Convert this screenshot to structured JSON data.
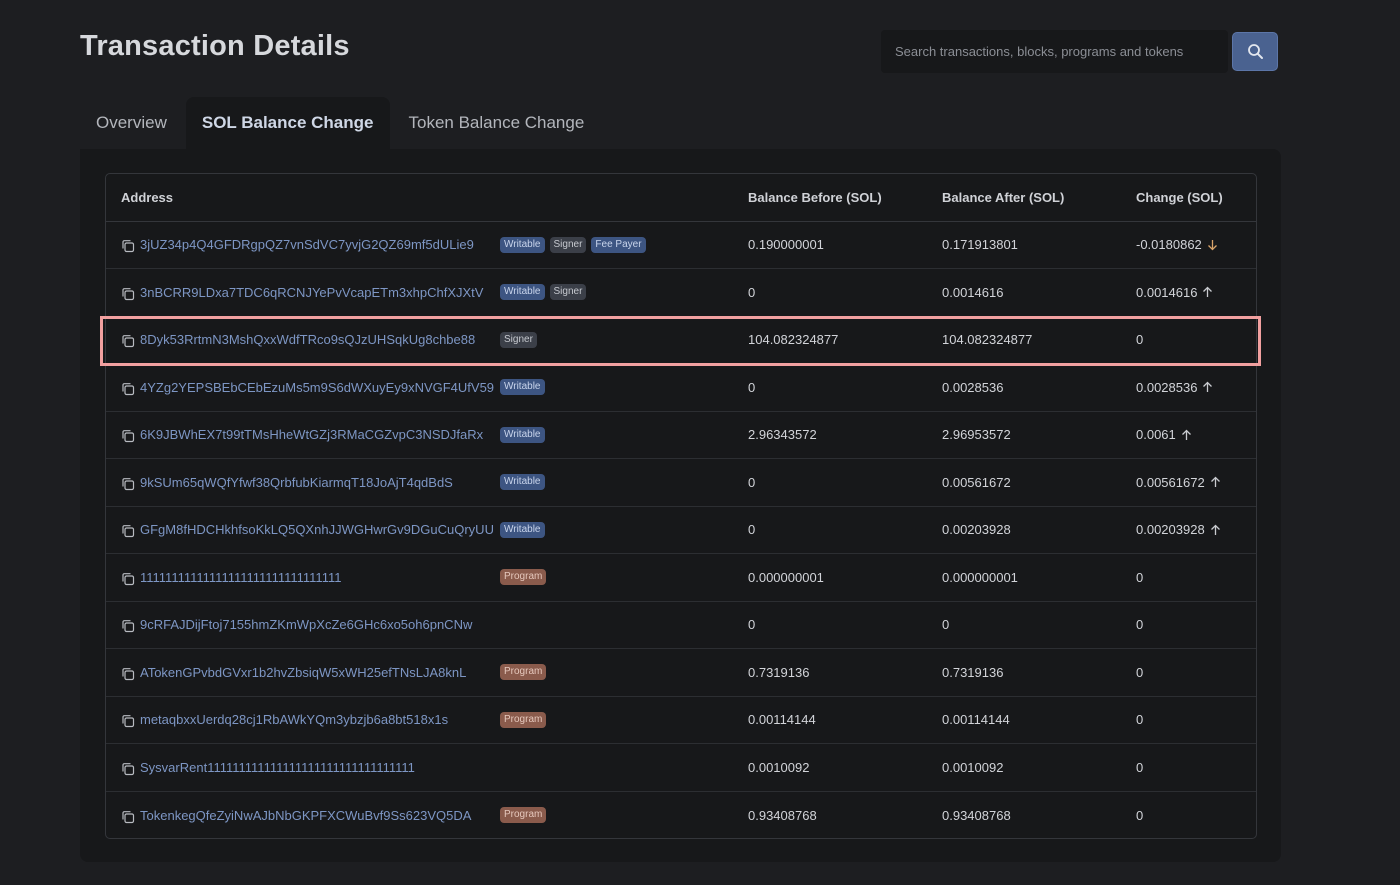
{
  "page": {
    "title": "Transaction Details"
  },
  "search": {
    "placeholder": "Search transactions, blocks, programs and tokens"
  },
  "tabs": [
    {
      "label": "Overview",
      "active": false
    },
    {
      "label": "SOL Balance Change",
      "active": true
    },
    {
      "label": "Token Balance Change",
      "active": false
    }
  ],
  "table": {
    "headers": {
      "address": "Address",
      "balance_before": "Balance Before (SOL)",
      "balance_after": "Balance After (SOL)",
      "change": "Change (SOL)"
    },
    "rows": [
      {
        "address": "3jUZ34p4Q4GFDRgpQZ7vnSdVC7yvjG2QZ69mf5dULie9",
        "badges": [
          "Writable",
          "Signer",
          "Fee Payer"
        ],
        "before": "0.190000001",
        "after": "0.171913801",
        "change": "-0.0180862",
        "direction": "down"
      },
      {
        "address": "3nBCRR9LDxa7TDC6qRCNJYePvVcapETm3xhpChfXJXtV",
        "badges": [
          "Writable",
          "Signer"
        ],
        "before": "0",
        "after": "0.0014616",
        "change": "0.0014616",
        "direction": "up"
      },
      {
        "address": "8Dyk53RrtmN3MshQxxWdfTRco9sQJzUHSqkUg8chbe88",
        "badges": [
          "Signer"
        ],
        "before": "104.082324877",
        "after": "104.082324877",
        "change": "0",
        "direction": "none"
      },
      {
        "address": "4YZg2YEPSBEbCEbEzuMs5m9S6dWXuyEy9xNVGF4UfV59",
        "badges": [
          "Writable"
        ],
        "before": "0",
        "after": "0.0028536",
        "change": "0.0028536",
        "direction": "up"
      },
      {
        "address": "6K9JBWhEX7t99tTMsHheWtGZj3RMaCGZvpC3NSDJfaRx",
        "badges": [
          "Writable"
        ],
        "before": "2.96343572",
        "after": "2.96953572",
        "change": "0.0061",
        "direction": "up"
      },
      {
        "address": "9kSUm65qWQfYfwf38QrbfubKiarmqT18JoAjT4qdBdS",
        "badges": [
          "Writable"
        ],
        "before": "0",
        "after": "0.00561672",
        "change": "0.00561672",
        "direction": "up"
      },
      {
        "address": "GFgM8fHDCHkhfsoKkLQ5QXnhJJWGHwrGv9DGuCuQryUU",
        "badges": [
          "Writable"
        ],
        "before": "0",
        "after": "0.00203928",
        "change": "0.00203928",
        "direction": "up"
      },
      {
        "address": "11111111111111111111111111111111",
        "badges": [
          "Program"
        ],
        "before": "0.000000001",
        "after": "0.000000001",
        "change": "0",
        "direction": "none"
      },
      {
        "address": "9cRFAJDijFtoj7155hmZKmWpXcZe6GHc6xo5oh6pnCNw",
        "badges": [],
        "before": "0",
        "after": "0",
        "change": "0",
        "direction": "none"
      },
      {
        "address": "ATokenGPvbdGVxr1b2hvZbsiqW5xWH25efTNsLJA8knL",
        "badges": [
          "Program"
        ],
        "before": "0.7319136",
        "after": "0.7319136",
        "change": "0",
        "direction": "none"
      },
      {
        "address": "metaqbxxUerdq28cj1RbAWkYQm3ybzjb6a8bt518x1s",
        "badges": [
          "Program"
        ],
        "before": "0.00114144",
        "after": "0.00114144",
        "change": "0",
        "direction": "none"
      },
      {
        "address": "SysvarRent111111111111111111111111111111111",
        "badges": [],
        "before": "0.0010092",
        "after": "0.0010092",
        "change": "0",
        "direction": "none"
      },
      {
        "address": "TokenkegQfeZyiNwAJbNbGKPFXCWuBvf9Ss623VQ5DA",
        "badges": [
          "Program"
        ],
        "before": "0.93408768",
        "after": "0.93408768",
        "change": "0",
        "direction": "none"
      }
    ]
  },
  "highlighted_row_index": 2,
  "icons": {
    "search": "search-icon",
    "copy": "copy-icon",
    "up": "arrow-up-icon",
    "down": "arrow-down-icon"
  },
  "colors": {
    "background": "#1d1e21",
    "panel": "#17181a",
    "link": "#7d96c4",
    "search_button": "#4a6290",
    "writable_badge": "#3d5582",
    "signer_badge": "#3b3f48",
    "program_badge": "#8a5b4c",
    "arrow_up": "#c9cbd0",
    "arrow_down": "#d9a46a",
    "highlight": "#f2a0a0"
  }
}
